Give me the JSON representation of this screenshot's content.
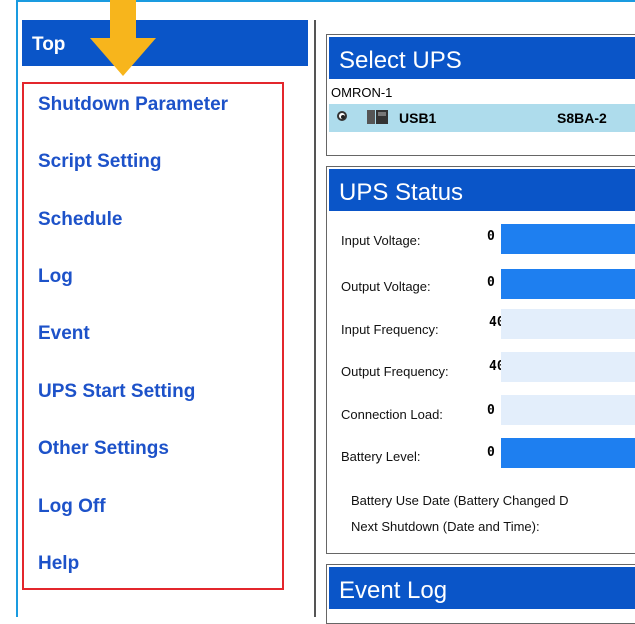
{
  "sidebar": {
    "top_label": "Top",
    "items": [
      {
        "label": "Shutdown Parameter"
      },
      {
        "label": "Script Setting"
      },
      {
        "label": "Schedule"
      },
      {
        "label": "Log"
      },
      {
        "label": "Event"
      },
      {
        "label": "UPS Start Setting"
      },
      {
        "label": "Other Settings"
      },
      {
        "label": "Log Off"
      },
      {
        "label": "Help"
      }
    ]
  },
  "select_ups": {
    "title": "Select UPS",
    "group_name": "OMRON-1",
    "connection": "USB1",
    "model": "S8BA-2"
  },
  "ups_status": {
    "title": "UPS Status",
    "rows": [
      {
        "label": "Input Voltage:",
        "value": "0",
        "bar_level": 1.0
      },
      {
        "label": "Output Voltage:",
        "value": "0",
        "bar_level": 1.0
      },
      {
        "label": "Input Frequency:",
        "value": "40",
        "bar_level": 0.0
      },
      {
        "label": "Output Frequency:",
        "value": "40",
        "bar_level": 0.0
      },
      {
        "label": "Connection Load:",
        "value": "0",
        "bar_level": 0.0
      },
      {
        "label": "Battery Level:",
        "value": "0",
        "bar_level": 1.0
      }
    ],
    "battery_use_date_label": "Battery Use Date (Battery Changed D",
    "next_shutdown_label": "Next Shutdown (Date and Time):"
  },
  "event_log": {
    "title": "Event Log"
  },
  "colors": {
    "accent_blue": "#0a55c8",
    "menu_text": "#1d52c9",
    "highlight_red": "#e3262c",
    "arrow_yellow": "#f7b51c",
    "bar_blue": "#1e7ff0"
  }
}
